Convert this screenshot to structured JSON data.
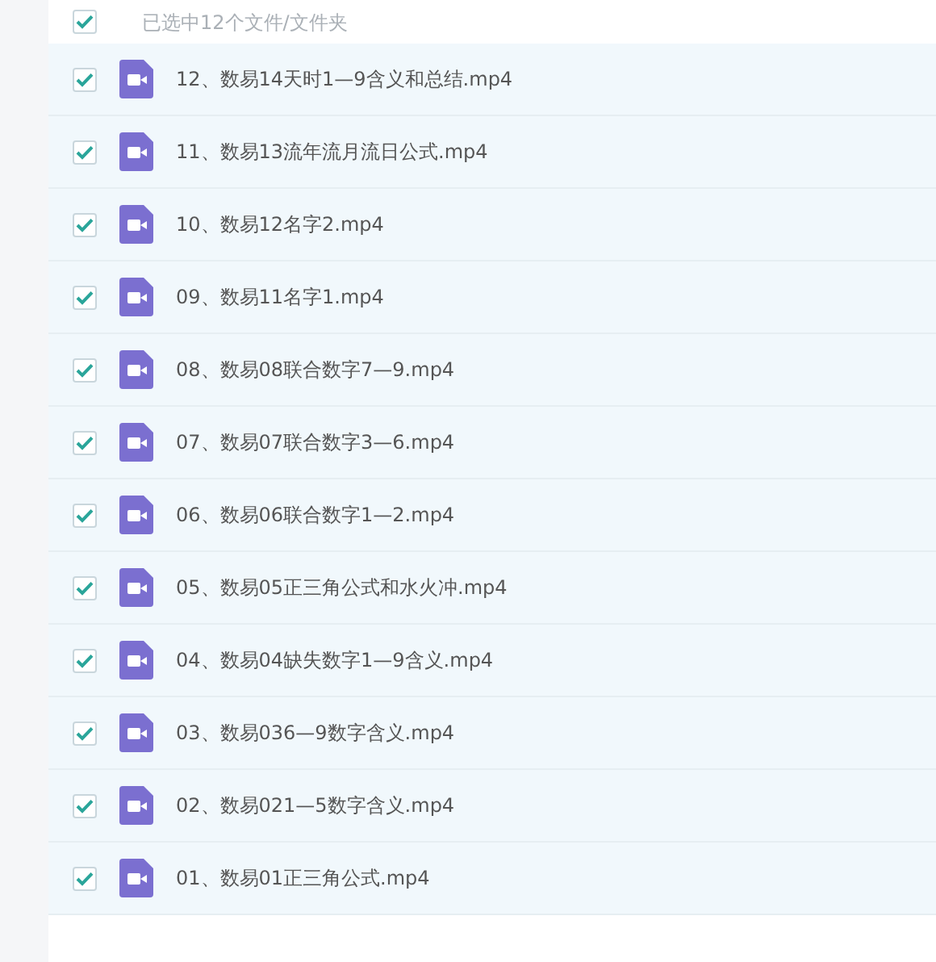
{
  "header": {
    "checked": true,
    "label": "已选中12个文件/文件夹"
  },
  "files": [
    {
      "name": "12、数易14天时1—9含义和总结.mp4",
      "selected": true
    },
    {
      "name": "11、数易13流年流月流日公式.mp4",
      "selected": true
    },
    {
      "name": "10、数易12名字2.mp4",
      "selected": true
    },
    {
      "name": "09、数易11名字1.mp4",
      "selected": true
    },
    {
      "name": "08、数易08联合数字7—9.mp4",
      "selected": true
    },
    {
      "name": "07、数易07联合数字3—6.mp4",
      "selected": true
    },
    {
      "name": "06、数易06联合数字1—2.mp4",
      "selected": true
    },
    {
      "name": "05、数易05正三角公式和水火冲.mp4",
      "selected": true
    },
    {
      "name": "04、数易04缺失数字1—9含义.mp4",
      "selected": true
    },
    {
      "name": "03、数易036—9数字含义.mp4",
      "selected": true
    },
    {
      "name": "02、数易021—5数字含义.mp4",
      "selected": true
    },
    {
      "name": "01、数易01正三角公式.mp4",
      "selected": true
    }
  ]
}
